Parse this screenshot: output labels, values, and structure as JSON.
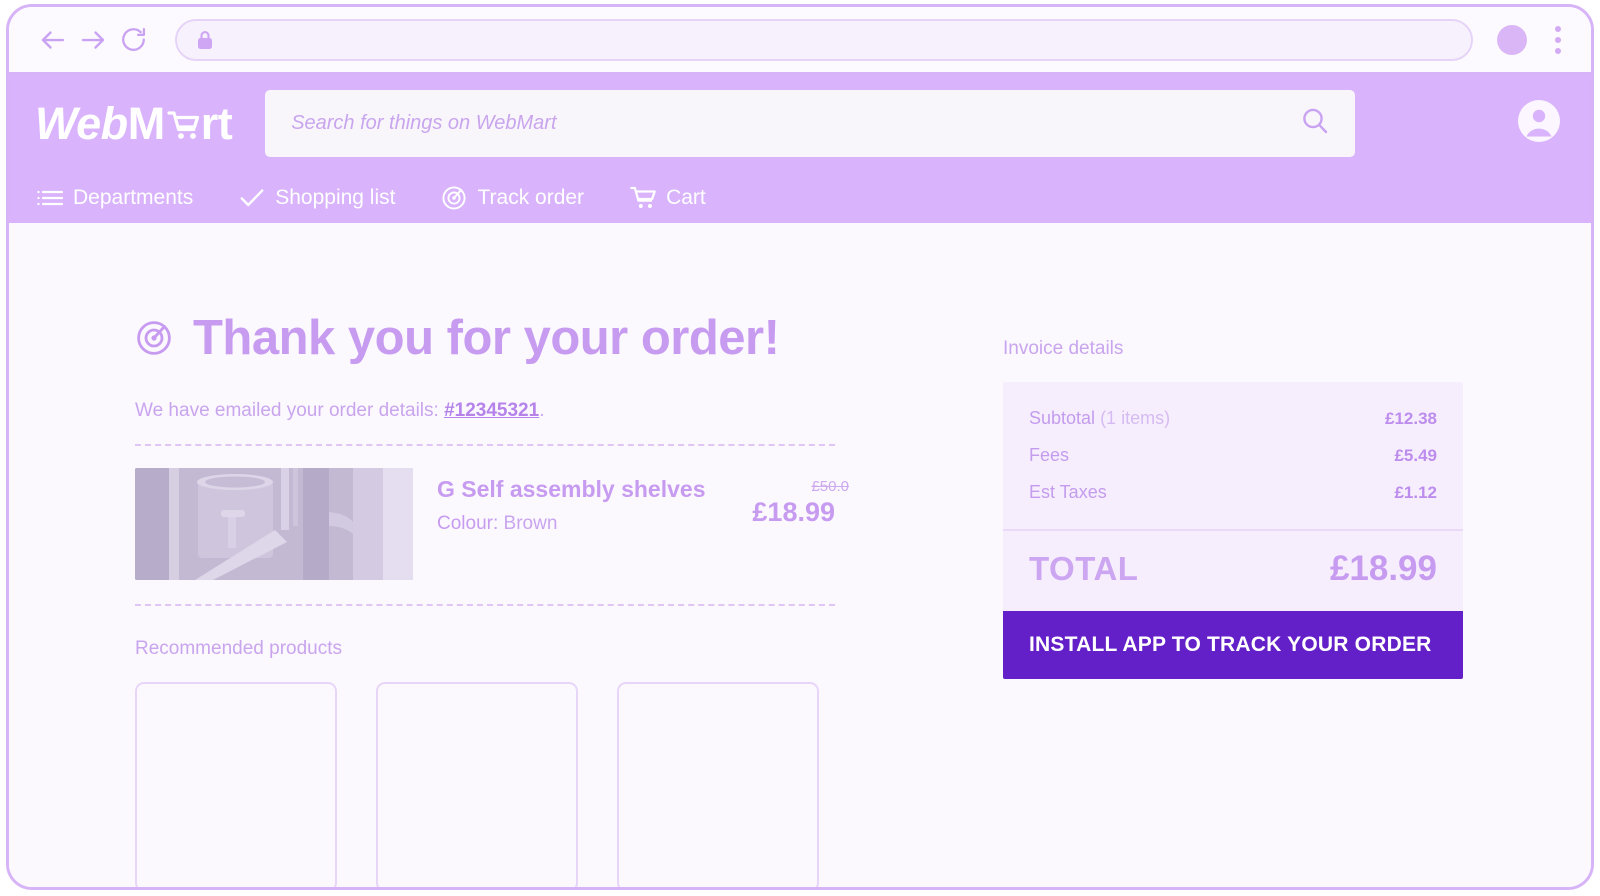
{
  "browser": {
    "back_icon": "back-arrow-icon",
    "forward_icon": "forward-arrow-icon",
    "reload_icon": "reload-icon",
    "lock_icon": "lock-icon",
    "url_value": "",
    "url_placeholder": "",
    "profile_icon": "profile-avatar-icon",
    "menu_icon": "kebab-menu-icon"
  },
  "header": {
    "logo": {
      "part1": "Web",
      "part2": "M",
      "cart_icon": "shopping-cart-icon",
      "part3": "rt"
    },
    "search": {
      "placeholder": "Search for things on WebMart",
      "value": "",
      "icon": "search-icon"
    },
    "account_icon": "account-circle-icon",
    "nav": [
      {
        "label": "Departments",
        "icon": "menu-list-icon"
      },
      {
        "label": "Shopping list",
        "icon": "check-icon"
      },
      {
        "label": "Track order",
        "icon": "radar-target-icon"
      },
      {
        "label": "Cart",
        "icon": "shopping-cart-icon"
      }
    ]
  },
  "main": {
    "title": "Thank you for your order!",
    "title_icon": "radar-target-icon",
    "email_prefix": "We have emailed your order details: ",
    "order_number": "#12345321",
    "email_suffix": ".",
    "order_item": {
      "image_alt": "product-photo",
      "name": "G Self assembly shelves",
      "attribute_label": "Colour:",
      "attribute_value": "Brown",
      "old_price": "£50.0",
      "price": "£18.99"
    },
    "recommended_title": "Recommended products",
    "recommended_cards": [
      {
        "name": ""
      },
      {
        "name": ""
      },
      {
        "name": ""
      }
    ]
  },
  "invoice": {
    "title": "Invoice details",
    "rows": [
      {
        "label": "Subtotal",
        "sublabel": " (1 items)",
        "amount": "£12.38"
      },
      {
        "label": "Fees",
        "sublabel": "",
        "amount": "£5.49"
      },
      {
        "label": "Est Taxes",
        "sublabel": "",
        "amount": "£1.12"
      }
    ],
    "total_label": "TOTAL",
    "total_amount": "£18.99",
    "cta_label": "INSTALL APP TO TRACK YOUR ORDER"
  },
  "colors": {
    "brand_purple": "#d9b3fb",
    "accent_text": "#c79bf0",
    "cta_bg": "#6420c8",
    "page_bg": "#fbf8fe",
    "card_bg": "#f6eefd"
  }
}
